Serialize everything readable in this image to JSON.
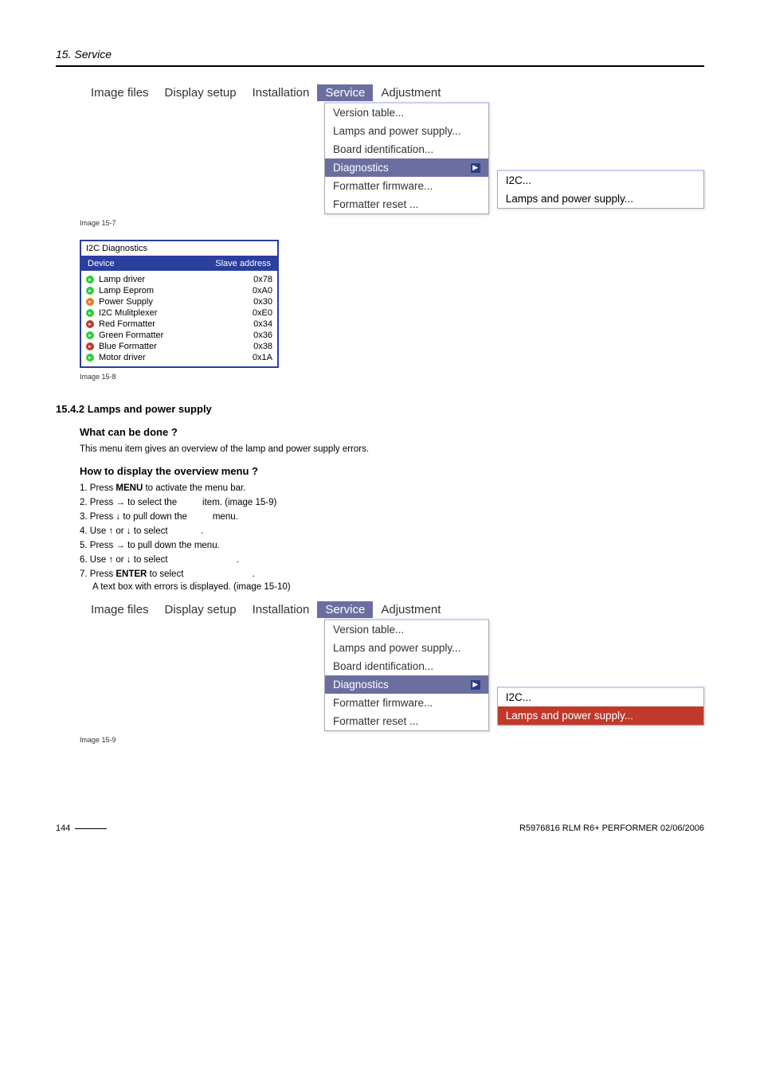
{
  "header": {
    "section": "15. Service"
  },
  "figure_a": {
    "menubar": [
      "Image files",
      "Display setup",
      "Installation",
      "Service",
      "Adjustment"
    ],
    "active_index": 3,
    "dropdown": [
      "Version table...",
      "Lamps and power supply...",
      "Board identification...",
      "Diagnostics",
      "Formatter firmware...",
      "Formatter reset ..."
    ],
    "dropdown_hl_index": 3,
    "submenu": [
      "I2C...",
      "Lamps and power supply..."
    ],
    "submenu_hl_index": 0,
    "caption": "Image 15-7"
  },
  "diag": {
    "title": "I2C Diagnostics",
    "col_device": "Device",
    "col_addr": "Slave address",
    "rows": [
      {
        "color": "green",
        "name": "Lamp driver",
        "addr": "0x78"
      },
      {
        "color": "green",
        "name": "Lamp Eeprom",
        "addr": "0xA0"
      },
      {
        "color": "orange",
        "name": "Power Supply",
        "addr": "0x30"
      },
      {
        "color": "green",
        "name": "I2C Mulitplexer",
        "addr": "0xE0"
      },
      {
        "color": "red",
        "name": "Red Formatter",
        "addr": "0x34"
      },
      {
        "color": "green",
        "name": "Green Formatter",
        "addr": "0x36"
      },
      {
        "color": "red",
        "name": "Blue Formatter",
        "addr": "0x38"
      },
      {
        "color": "green",
        "name": "Motor driver",
        "addr": "0x1A"
      }
    ],
    "caption": "Image 15-8"
  },
  "sec": {
    "num_title": "15.4.2  Lamps and power supply",
    "q1": "What can be done ?",
    "a1": "This menu item gives an overview of the lamp and power supply errors.",
    "q2": "How to display the overview menu ?",
    "steps": {
      "s1a": "Press ",
      "s1b": "MENU",
      "s1c": " to activate the menu bar.",
      "s2a": "Press → to select the ",
      "s2b": " item. (image 15-9)",
      "s3a": "Press ↓ to pull down the ",
      "s3b": " menu.",
      "s4a": "Use ↑ or ↓ to select ",
      "s4b": ".",
      "s5": "Press → to pull down the menu.",
      "s6a": "Use ↑ or ↓ to select ",
      "s6b": ".",
      "s7a": "Press ",
      "s7b": "ENTER",
      "s7c": " to select ",
      "s7d": ".",
      "s7e": "A text box with errors is displayed. (image 15-10)"
    }
  },
  "figure_b": {
    "menubar": [
      "Image files",
      "Display setup",
      "Installation",
      "Service",
      "Adjustment"
    ],
    "active_index": 3,
    "dropdown": [
      "Version table...",
      "Lamps and power supply...",
      "Board identification...",
      "Diagnostics",
      "Formatter firmware...",
      "Formatter reset ..."
    ],
    "dropdown_hl_index": 3,
    "submenu": [
      "I2C...",
      "Lamps and power supply..."
    ],
    "submenu_hl_index": 1,
    "caption": "Image 15-9"
  },
  "footer": {
    "page": "144",
    "doc": "R5976816  RLM R6+ PERFORMER  02/06/2006"
  }
}
